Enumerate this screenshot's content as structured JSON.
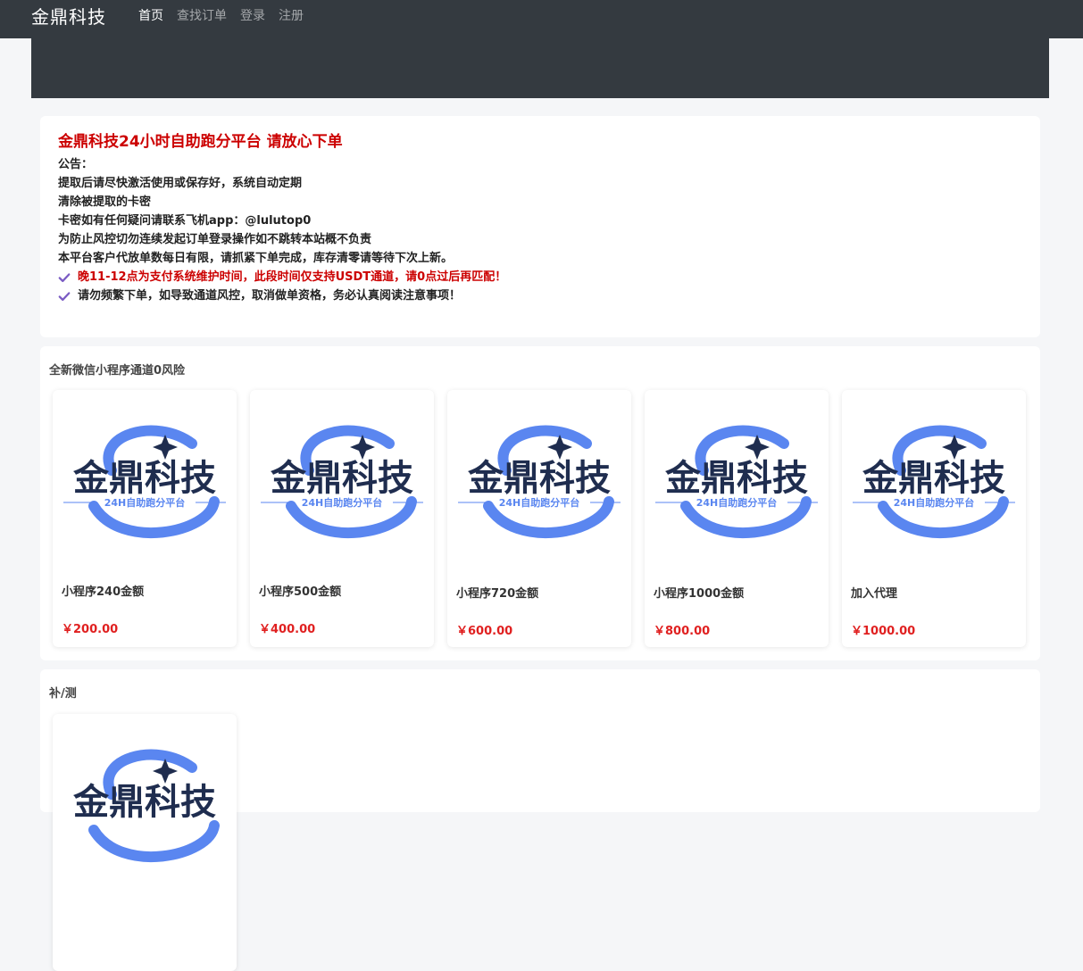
{
  "nav": {
    "brand": "金鼎科技",
    "items": [
      "首页",
      "查找订单",
      "登录",
      "注册"
    ]
  },
  "notice": {
    "title": "金鼎科技24小时自助跑分平台 请放心下单",
    "lines": [
      "公告：",
      "提取后请尽快激活使用或保存好，系统自动定期",
      "清除被提取的卡密",
      "卡密如有任何疑问请联系飞机app：@lulutop0",
      "为防止风控切勿连续发起订单登录操作如不跳转本站概不负责",
      "本平台客户代放单数每日有限，请抓紧下单完成，库存清零请等待下次上新。"
    ],
    "check_red": "晚11-12点为支付系统维护时间，此段时间仅支持USDT通道，请0点过后再匹配！",
    "check_dark": "请勿频繁下单，如导致通道风控，取消做单资格，务必认真阅读注意事项！"
  },
  "section1": {
    "title": "全新微信小程序通道0风险",
    "products": [
      {
        "name": "小程序240金额",
        "price": "￥200.00"
      },
      {
        "name": "小程序500金额",
        "price": "￥400.00"
      },
      {
        "name": "小程序720金额",
        "price": "￥600.00"
      },
      {
        "name": "小程序1000金额",
        "price": "￥800.00"
      },
      {
        "name": "加入代理",
        "price": "￥1000.00"
      }
    ]
  },
  "section2": {
    "title": "补/测"
  },
  "logo": {
    "main": "金鼎科技",
    "sub": "24H自助跑分平台"
  },
  "colors": {
    "navbar": "#343a40",
    "notice_red": "#cc0000",
    "price_red": "#e02020",
    "check_purple": "#7b5cc4",
    "logo_blue": "#5a86f0",
    "logo_navy": "#1f2d4f"
  }
}
